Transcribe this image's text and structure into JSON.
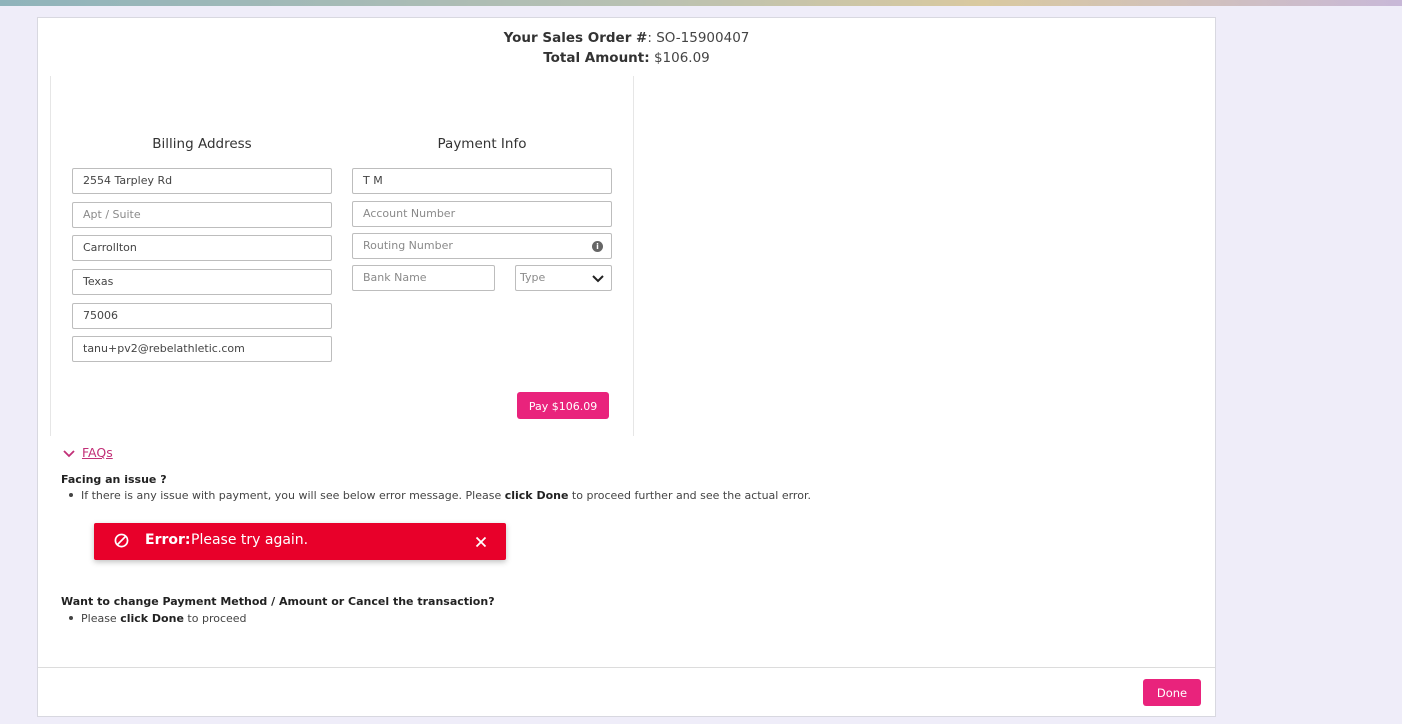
{
  "order": {
    "so_label": "Your Sales Order #",
    "so_value": ": SO-15900407",
    "total_label": "Total Amount:",
    "total_value": " $106.09"
  },
  "billing": {
    "title": "Billing Address",
    "address1": "2554 Tarpley Rd",
    "apt_placeholder": "Apt / Suite",
    "city": "Carrollton",
    "state": "Texas",
    "zip": "75006",
    "email": "tanu+pv2@rebelathletic.com"
  },
  "payment": {
    "title": "Payment Info",
    "name": "T M",
    "account_placeholder": "Account Number",
    "routing_placeholder": "Routing Number",
    "bank_placeholder": "Bank Name",
    "type_selected": "Type",
    "pay_button": "Pay $106.09"
  },
  "faq": {
    "toggle_label": "FAQs",
    "issue_title": "Facing an issue ?",
    "issue_text_1": "If there is any issue with payment, you will see below error message. Please ",
    "issue_text_bold": "click Done",
    "issue_text_2": " to proceed further and see the actual error.",
    "change_title": "Want to change Payment Method / Amount or Cancel the transaction?",
    "change_text_1": "Please ",
    "change_text_bold": "click Done",
    "change_text_2": " to proceed"
  },
  "error_toast": {
    "label": "Error:",
    "message": "Please try again."
  },
  "footer": {
    "done_button": "Done"
  },
  "colors": {
    "accent": "#e9237c",
    "error": "#e8002a",
    "faq_link": "#c22f77",
    "page_bg": "#efedf9"
  }
}
